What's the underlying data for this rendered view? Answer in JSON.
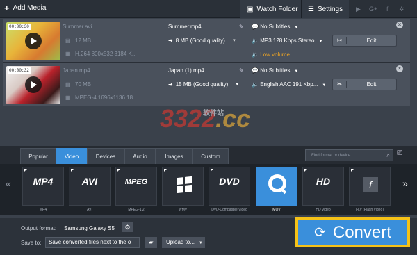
{
  "toolbar": {
    "add_media": "Add Media",
    "watch_folder": "Watch Folder",
    "settings": "Settings"
  },
  "social": [
    "youtube-icon",
    "google-plus-icon",
    "facebook-icon",
    "vk-icon"
  ],
  "files": [
    {
      "timecode": "00:00:30",
      "name": "Summer.avi",
      "size": "12 MB",
      "codec": "H.264 800x532 3184 K...",
      "out_name": "Summer.mp4",
      "out_size": "8 MB (Good quality)",
      "subtitles": "No Subtitles",
      "audio": "MP3 128 Kbps Stereo",
      "edit": "Edit",
      "warning": "Low volume"
    },
    {
      "timecode": "00:00:32",
      "name": "Japan.mp4",
      "size": "70 MB",
      "codec": "MPEG-4 1696x1136 18...",
      "out_name": "Japan (1).mp4",
      "out_size": "15 MB (Good quality)",
      "subtitles": "No Subtitles",
      "audio": "English AAC 191 Kbp...",
      "edit": "Edit"
    }
  ],
  "watermark": {
    "digits": "3322",
    "cc": ".cc",
    "cn": "软件站"
  },
  "tabs": [
    "Popular",
    "Video",
    "Devices",
    "Audio",
    "Images",
    "Custom"
  ],
  "active_tab": "Video",
  "search": {
    "placeholder": "Find format or device..."
  },
  "formats": [
    {
      "logo": "MP4",
      "label": "MP4"
    },
    {
      "logo": "AVI",
      "label": "AVI"
    },
    {
      "logo": "MPEG",
      "label": "MPEG-1,2"
    },
    {
      "logo": "",
      "label": "WMV"
    },
    {
      "logo": "DVD",
      "label": "DVD-Compatible Video"
    },
    {
      "logo": "",
      "label": "MOV"
    },
    {
      "logo": "HD",
      "label": "HD Video"
    },
    {
      "logo": "f",
      "label": "FLV (Flash Video)"
    }
  ],
  "bottom": {
    "output_label": "Output format:",
    "output_value": "Samsung Galaxy S5",
    "save_label": "Save to:",
    "save_value": "Save converted files next to the o",
    "upload": "Upload to...",
    "convert": "Convert"
  },
  "colors": {
    "accent": "#3a8fdb",
    "convert_border": "#f5c218",
    "warning": "#f0a623"
  }
}
